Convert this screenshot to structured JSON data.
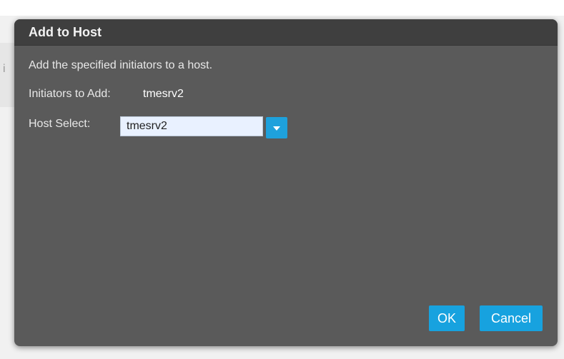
{
  "dialog": {
    "title": "Add to Host",
    "description": "Add the specified initiators to a host.",
    "initiators_label": "Initiators to Add:",
    "initiators_value": "tmesrv2",
    "host_select_label": "Host Select:",
    "host_select_value": "tmesrv2",
    "ok_label": "OK",
    "cancel_label": "Cancel"
  },
  "background": {
    "partial_text": "i"
  },
  "colors": {
    "dialog_bg": "#5a5a5a",
    "header_bg": "#3f3f3f",
    "accent": "#17a2df",
    "input_bg": "#e9f1ff"
  },
  "icons": {
    "dropdown": "chevron-down-icon"
  }
}
